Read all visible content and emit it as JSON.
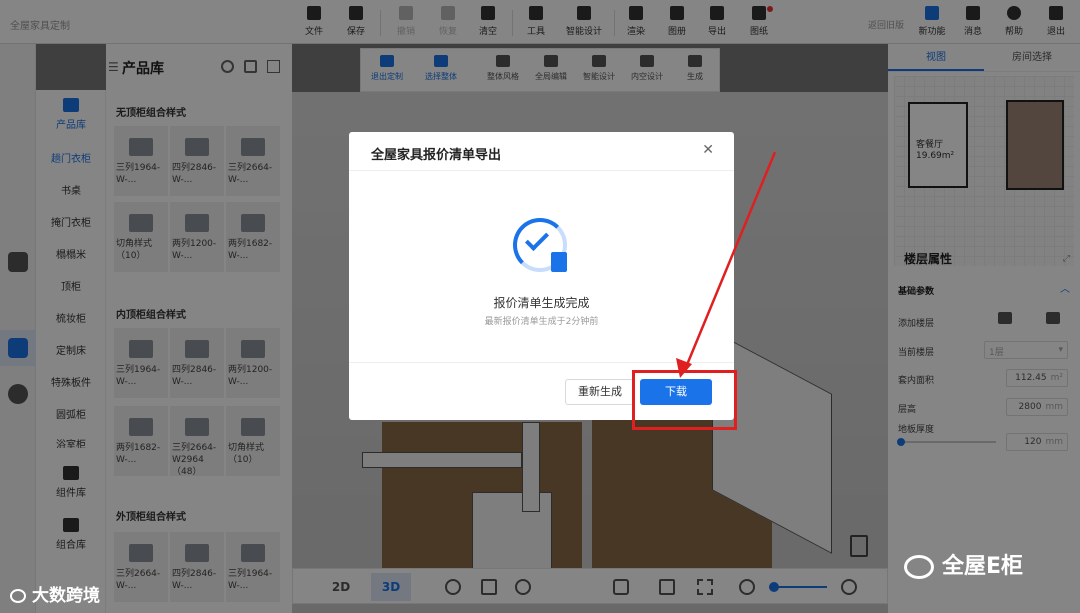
{
  "app": {
    "name": "全屋家具定制"
  },
  "toolbar": {
    "file": "文件",
    "save": "保存",
    "undo": "撤销",
    "redo": "恢复",
    "clear": "清空",
    "tools": "工具",
    "smart_design": "智能设计",
    "render": "渲染",
    "album": "图册",
    "export": "导出",
    "drawings": "图纸",
    "return_old": "返回旧版",
    "new_feature": "新功能",
    "messages": "消息",
    "help": "帮助",
    "exit": "退出"
  },
  "subbar": {
    "exit_custom": "退出定制",
    "select_whole": "选择整体",
    "whole_style": "整体风格",
    "whole_edit": "全局编辑",
    "smart_design": "智能设计",
    "internal_design": "内空设计",
    "generate": "生成"
  },
  "sidebar": {
    "product_library": "产品库",
    "categories": [
      "趟门衣柜",
      "书桌",
      "掩门衣柜",
      "榻榻米",
      "顶柜",
      "梳妆柜",
      "定制床",
      "特殊板件",
      "圆弧柜",
      "浴室柜"
    ],
    "component_lib": "组件库",
    "combo_lib": "组合库"
  },
  "product_library": {
    "title": "产品库",
    "sections": [
      {
        "title": "无顶柜组合样式",
        "items": [
          "三列1964-\nW-...",
          "四列2846-\nW-...",
          "三列2664-\nW-...",
          "切角样式\n（10）",
          "两列1200-\nW-...",
          "两列1682-\nW-..."
        ]
      },
      {
        "title": "内顶柜组合样式",
        "items": [
          "三列1964-\nW-...",
          "四列2846-\nW-...",
          "两列1200-\nW-...",
          "两列1682-\nW-...",
          "三列2664-\nW2964（48）",
          "切角样式\n（10）"
        ]
      },
      {
        "title": "外顶柜组合样式",
        "items": [
          "三列2664-\nW-...",
          "四列2846-\nW-...",
          "三列1964-\nW-..."
        ]
      }
    ]
  },
  "right_panel": {
    "tabs": [
      "视图",
      "房间选择"
    ],
    "plan_label": "客餐厅\n19.69m²",
    "floor_props_title": "楼层属性",
    "basic_params": "基础参数",
    "add_floor": "添加楼层",
    "current_floor": "当前楼层",
    "current_floor_value": "1层",
    "indoor_area": "套内面积",
    "indoor_area_value": "112.45",
    "indoor_area_unit": "m²",
    "floor_height": "层高",
    "floor_height_value": "2800",
    "floor_height_unit": "mm",
    "floor_thickness": "地板厚度",
    "floor_thickness_value": "120",
    "floor_thickness_unit": "mm"
  },
  "bottom_bar": {
    "view_2d": "2D",
    "view_3d": "3D",
    "active_view": "3D"
  },
  "modal": {
    "title": "全屋家具报价清单导出",
    "status": "报价清单生成完成",
    "subtitle": "最新报价清单生成于2分钟前",
    "regenerate": "重新生成",
    "download": "下载"
  },
  "watermarks": {
    "left": "大数跨境",
    "right": "全屋E柜"
  },
  "colors": {
    "accent": "#1a73e8",
    "highlight": "#e02020"
  }
}
